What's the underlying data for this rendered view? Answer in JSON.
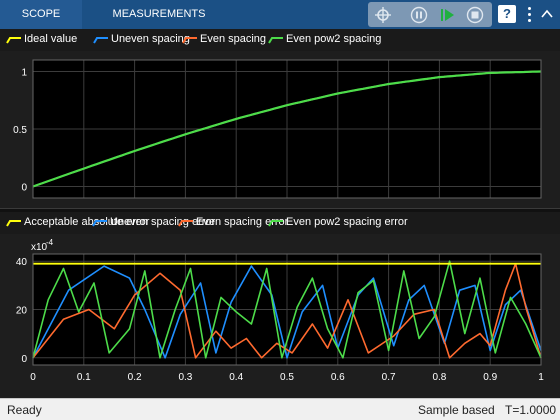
{
  "toolbar": {
    "tabs": [
      "SCOPE",
      "MEASUREMENTS"
    ],
    "help_label": "?"
  },
  "top_plot": {
    "legend": [
      "Ideal value",
      "Uneven spacing",
      "Even spacing",
      "Even pow2 spacing"
    ],
    "yticks": [
      "1",
      "0.5",
      "0"
    ]
  },
  "bottom_plot": {
    "legend": [
      "Acceptable absolute error",
      "Uneven spacing error",
      "Even spacing error",
      "Even pow2 spacing error"
    ],
    "exponent": "x10",
    "exponent_power": "-4",
    "yticks": [
      "40",
      "20",
      "0"
    ],
    "xticks": [
      "0",
      "0.1",
      "0.2",
      "0.3",
      "0.4",
      "0.5",
      "0.6",
      "0.7",
      "0.8",
      "0.9",
      "1"
    ]
  },
  "colors": {
    "ideal": "#ffff0d",
    "uneven": "#1f8fff",
    "even": "#ff6a2f",
    "pow2": "#4ddc4a",
    "grid": "#3c3c3c",
    "axes_bg": "#000000",
    "toolbar": "#1b5085"
  },
  "status": {
    "left": "Ready",
    "mode": "Sample based",
    "time": "T=1.0000"
  },
  "chart_data": [
    {
      "type": "line",
      "x": [
        0,
        0.1,
        0.2,
        0.3,
        0.4,
        0.5,
        0.6,
        0.7,
        0.8,
        0.9,
        1.0
      ],
      "series": [
        {
          "name": "Ideal value",
          "values": [
            0,
            0.156,
            0.309,
            0.454,
            0.588,
            0.707,
            0.809,
            0.891,
            0.951,
            0.988,
            1.0
          ]
        },
        {
          "name": "Uneven spacing",
          "values": [
            0,
            0.156,
            0.309,
            0.454,
            0.588,
            0.707,
            0.809,
            0.891,
            0.951,
            0.988,
            1.0
          ]
        },
        {
          "name": "Even spacing",
          "values": [
            0,
            0.156,
            0.309,
            0.454,
            0.588,
            0.707,
            0.809,
            0.891,
            0.951,
            0.988,
            1.0
          ]
        },
        {
          "name": "Even pow2 spacing",
          "values": [
            0,
            0.156,
            0.309,
            0.454,
            0.588,
            0.707,
            0.809,
            0.891,
            0.951,
            0.988,
            1.0
          ]
        }
      ],
      "ylim": [
        -0.1,
        1.1
      ],
      "xlim": [
        0,
        1
      ],
      "grid": true
    },
    {
      "type": "line",
      "xlim": [
        0,
        1
      ],
      "ylim": [
        -3,
        43
      ],
      "grid": true,
      "series": [
        {
          "name": "Acceptable absolute error",
          "x": [
            0,
            1
          ],
          "values": [
            39,
            39
          ]
        },
        {
          "name": "Uneven spacing error",
          "x": [
            0,
            0.07,
            0.14,
            0.19,
            0.22,
            0.26,
            0.29,
            0.33,
            0.36,
            0.39,
            0.43,
            0.47,
            0.5,
            0.53,
            0.57,
            0.6,
            0.64,
            0.67,
            0.71,
            0.74,
            0.77,
            0.81,
            0.84,
            0.87,
            0.9,
            0.93,
            0.96,
            1.0
          ],
          "values": [
            0,
            28,
            38,
            33,
            20,
            0,
            18,
            31,
            2,
            23,
            38,
            26,
            0,
            19,
            30,
            4,
            26,
            33,
            5,
            24,
            30,
            6,
            28,
            30,
            3,
            22,
            28,
            3
          ]
        },
        {
          "name": "Even spacing error",
          "x": [
            0,
            0.06,
            0.11,
            0.16,
            0.2,
            0.25,
            0.29,
            0.32,
            0.36,
            0.39,
            0.42,
            0.45,
            0.48,
            0.51,
            0.55,
            0.58,
            0.62,
            0.66,
            0.71,
            0.75,
            0.79,
            0.82,
            0.85,
            0.88,
            0.9,
            0.93,
            0.95,
            0.97,
            1.0
          ],
          "values": [
            0,
            16,
            20,
            12,
            26,
            35,
            28,
            0,
            11,
            4,
            8,
            0,
            6,
            2,
            14,
            4,
            24,
            2,
            9,
            18,
            20,
            0,
            6,
            10,
            5,
            28,
            39,
            21,
            0
          ]
        },
        {
          "name": "Even pow2 spacing error",
          "x": [
            0,
            0.03,
            0.06,
            0.09,
            0.12,
            0.15,
            0.19,
            0.22,
            0.25,
            0.28,
            0.31,
            0.34,
            0.37,
            0.4,
            0.43,
            0.46,
            0.49,
            0.52,
            0.55,
            0.58,
            0.61,
            0.64,
            0.67,
            0.7,
            0.73,
            0.76,
            0.79,
            0.82,
            0.85,
            0.88,
            0.91,
            0.94,
            0.97,
            1.0
          ],
          "values": [
            0,
            24,
            37,
            19,
            31,
            2,
            12,
            36,
            0,
            20,
            37,
            0,
            25,
            19,
            14,
            37,
            0,
            21,
            33,
            12,
            0,
            27,
            32,
            3,
            36,
            8,
            17,
            40,
            10,
            33,
            2,
            25,
            14,
            0
          ]
        }
      ]
    }
  ]
}
